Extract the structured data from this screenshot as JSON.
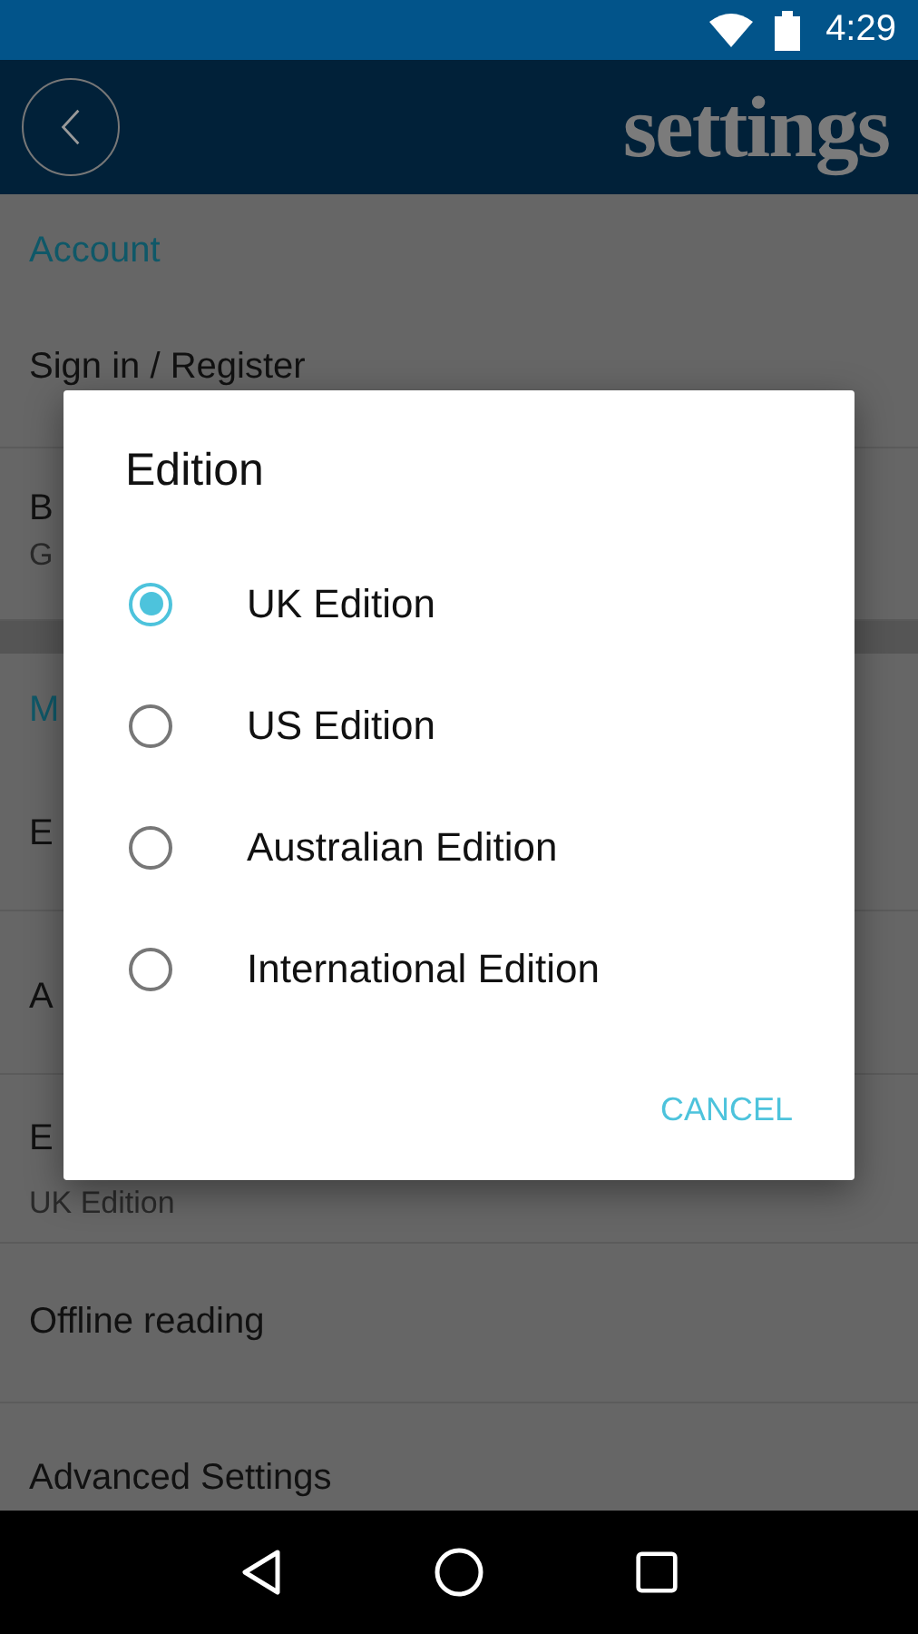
{
  "status_bar": {
    "time": "4:29"
  },
  "app_bar": {
    "title": "settings"
  },
  "sections": [
    {
      "header": "Account",
      "items": [
        {
          "title": "Sign in / Register"
        },
        {
          "title": "B",
          "subtitle": "G"
        }
      ]
    },
    {
      "header": "M",
      "items": [
        {
          "title": "E"
        },
        {
          "title": "A"
        },
        {
          "title": "E",
          "subtitle": "UK Edition"
        },
        {
          "title": "Offline reading"
        },
        {
          "title": "Advanced Settings"
        }
      ]
    }
  ],
  "dialog": {
    "title": "Edition",
    "options": [
      {
        "label": "UK Edition",
        "selected": true
      },
      {
        "label": "US Edition",
        "selected": false
      },
      {
        "label": "Australian Edition",
        "selected": false
      },
      {
        "label": "International Edition",
        "selected": false
      }
    ],
    "buttons": [
      "CANCEL"
    ]
  }
}
